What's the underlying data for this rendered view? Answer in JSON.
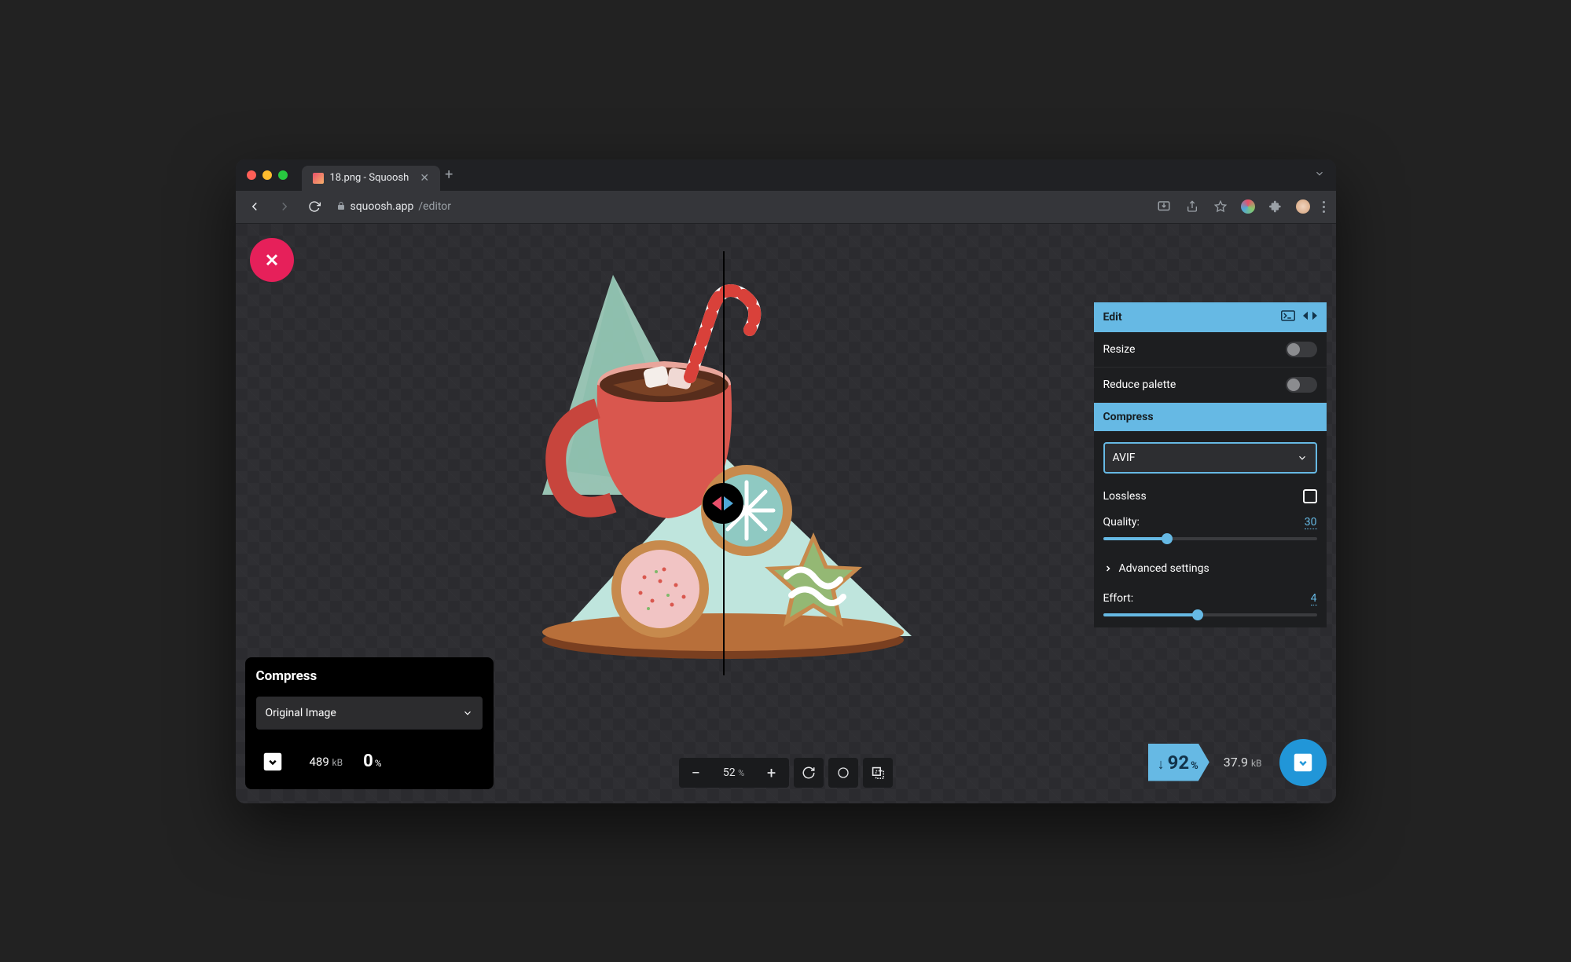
{
  "browser": {
    "tab_title": "18.png - Squoosh",
    "url_host": "squoosh.app",
    "url_path": "/editor"
  },
  "left_panel": {
    "title": "Compress",
    "select_value": "Original Image",
    "filesize_value": "489",
    "filesize_unit": "kB",
    "percent": "0"
  },
  "right_panel": {
    "edit_title": "Edit",
    "resize_label": "Resize",
    "reduce_label": "Reduce palette",
    "compress_title": "Compress",
    "codec": "AVIF",
    "lossless_label": "Lossless",
    "quality_label": "Quality:",
    "quality_value": "30",
    "advanced_label": "Advanced settings",
    "effort_label": "Effort:",
    "effort_value": "4",
    "effort_max": 9
  },
  "result": {
    "percent": "92",
    "filesize_value": "37.9",
    "filesize_unit": "kB"
  },
  "zoom": {
    "value": "52"
  }
}
